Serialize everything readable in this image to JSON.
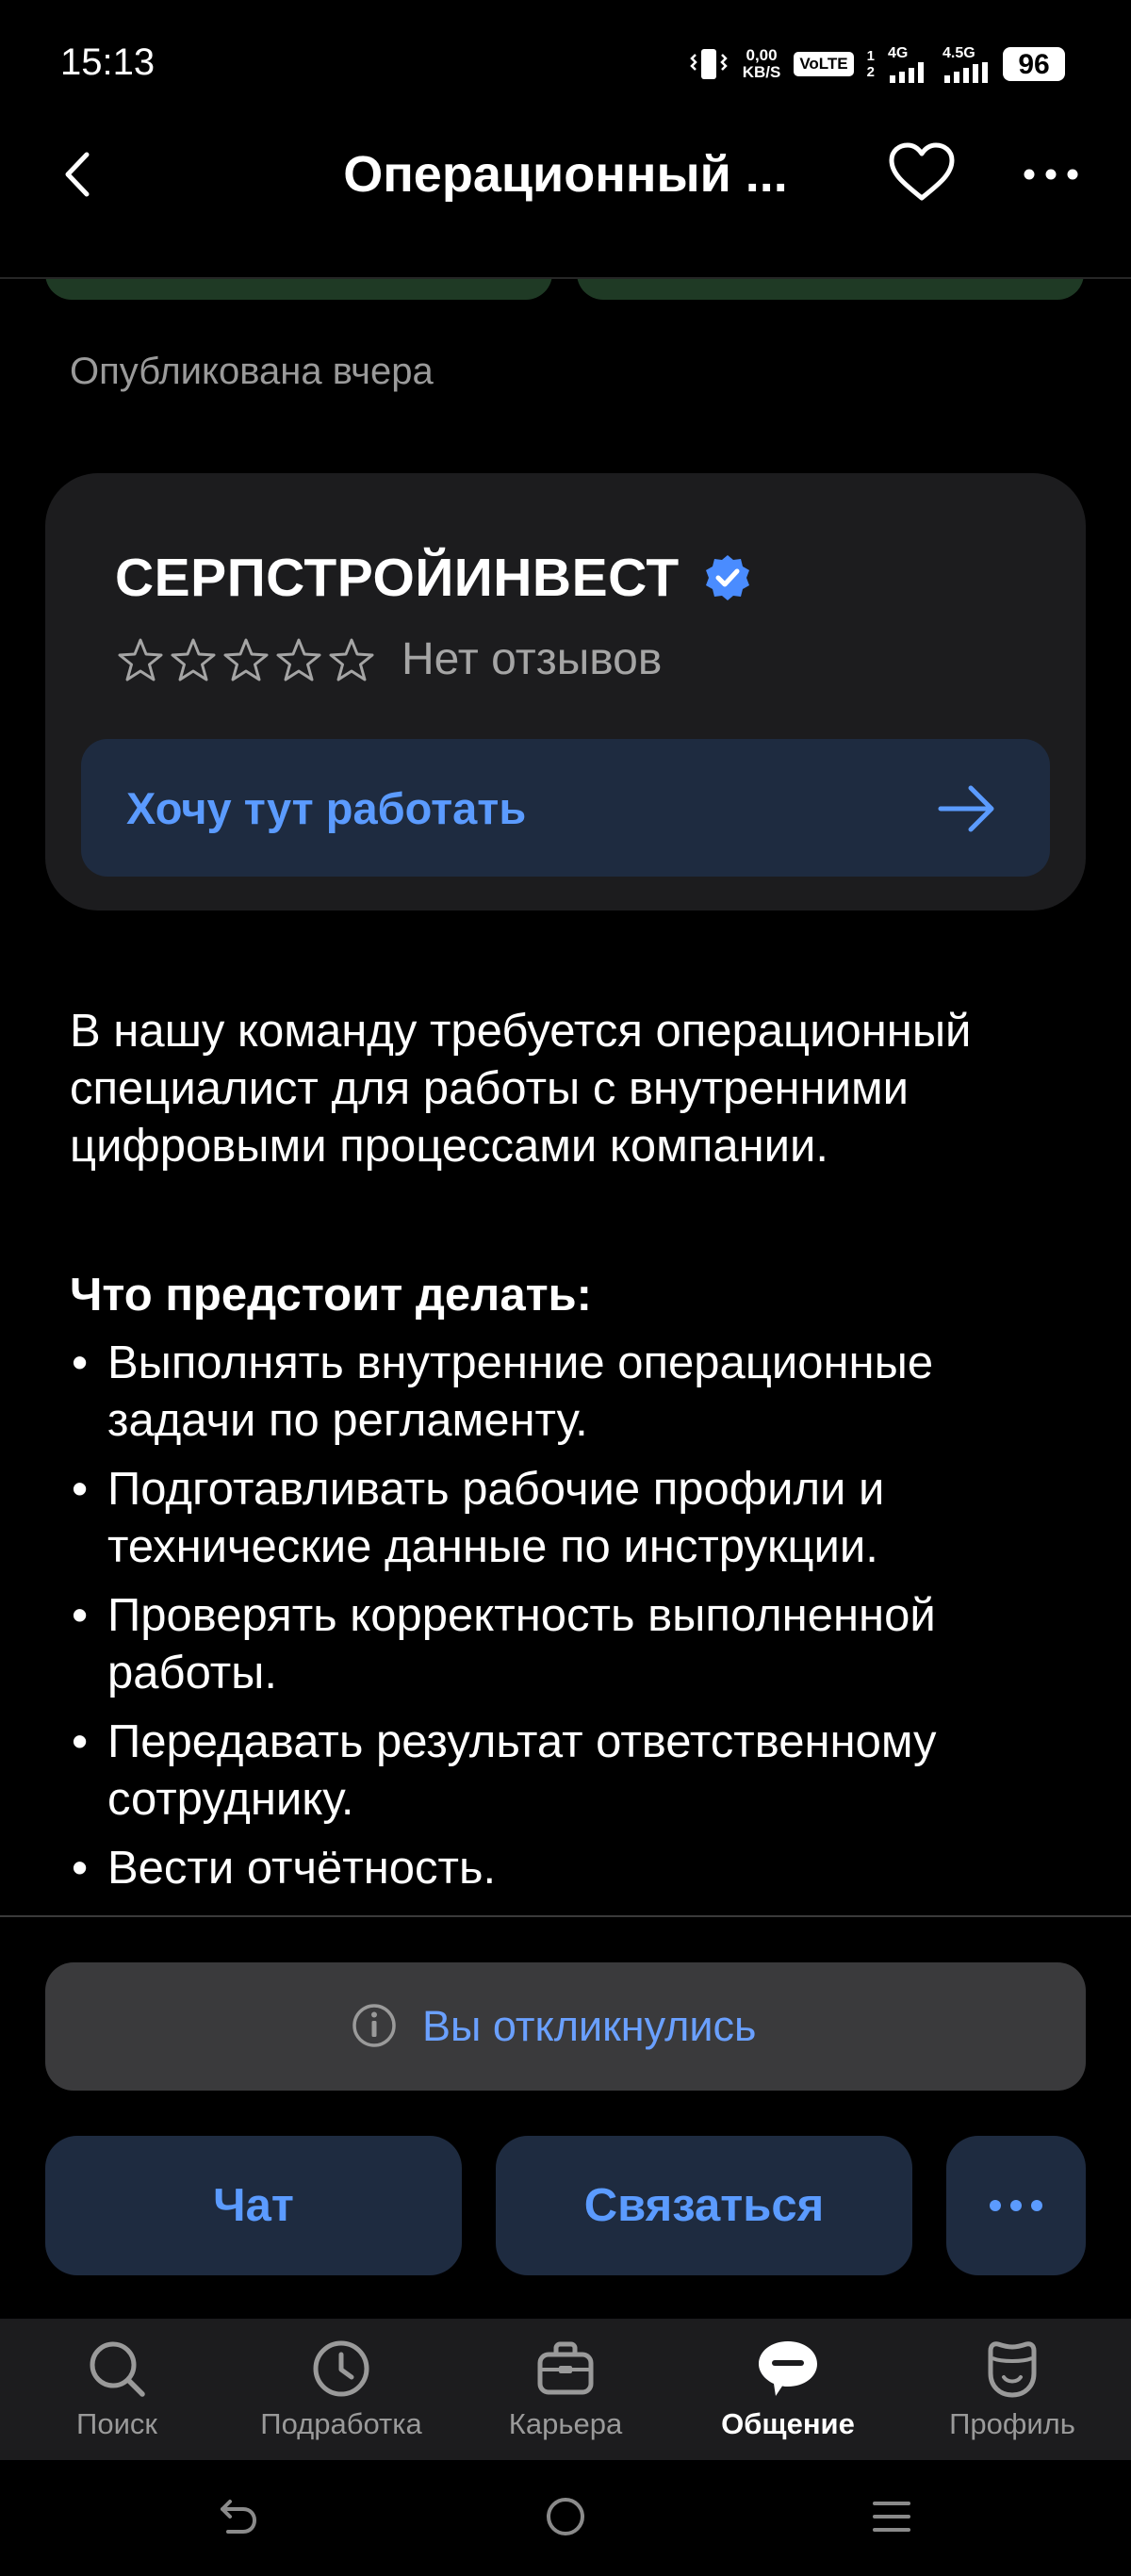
{
  "status_bar": {
    "time": "15:13",
    "net_speed_value": "0,00",
    "net_speed_unit": "KB/S",
    "volte": "VoLTE",
    "sim_1": "1",
    "sim_2": "2",
    "network_1": "4G",
    "network_2": "4.5G",
    "battery": "96"
  },
  "header": {
    "title": "Операционный ..."
  },
  "vacancy": {
    "published": "Опубликована вчера"
  },
  "company": {
    "name": "СЕРПСТРОЙИНВЕСТ",
    "rating": 0,
    "reviews": "Нет отзывов",
    "work_button": "Хочу тут работать"
  },
  "description": {
    "intro": "В нашу команду требуется операционный специалист для работы с внутренними цифровыми процессами компании.",
    "tasks_heading": "Что предстоит делать:",
    "tasks": [
      "Выполнять внутренние операционные задачи по регламенту.",
      "Подготавливать рабочие профили и технические данные по инструкции.",
      "Проверять корректность выполненной работы.",
      "Передавать результат ответственному сотруднику.",
      "Вести отчётность."
    ],
    "bullet": "•"
  },
  "response": {
    "label": "Вы откликнулись"
  },
  "actions": {
    "chat": "Чат",
    "contact": "Связаться",
    "more": "•••"
  },
  "tabs": [
    {
      "label": "Поиск",
      "icon": "search-icon"
    },
    {
      "label": "Подработка",
      "icon": "clock-icon"
    },
    {
      "label": "Карьера",
      "icon": "briefcase-icon"
    },
    {
      "label": "Общение",
      "icon": "chat-bubble-icon",
      "active": true
    },
    {
      "label": "Профиль",
      "icon": "profile-icon"
    }
  ],
  "colors": {
    "accent": "#5b9bff",
    "verified": "#4a8cff",
    "card_bg": "#1c1c1e",
    "button_bg": "#1e2b40"
  }
}
